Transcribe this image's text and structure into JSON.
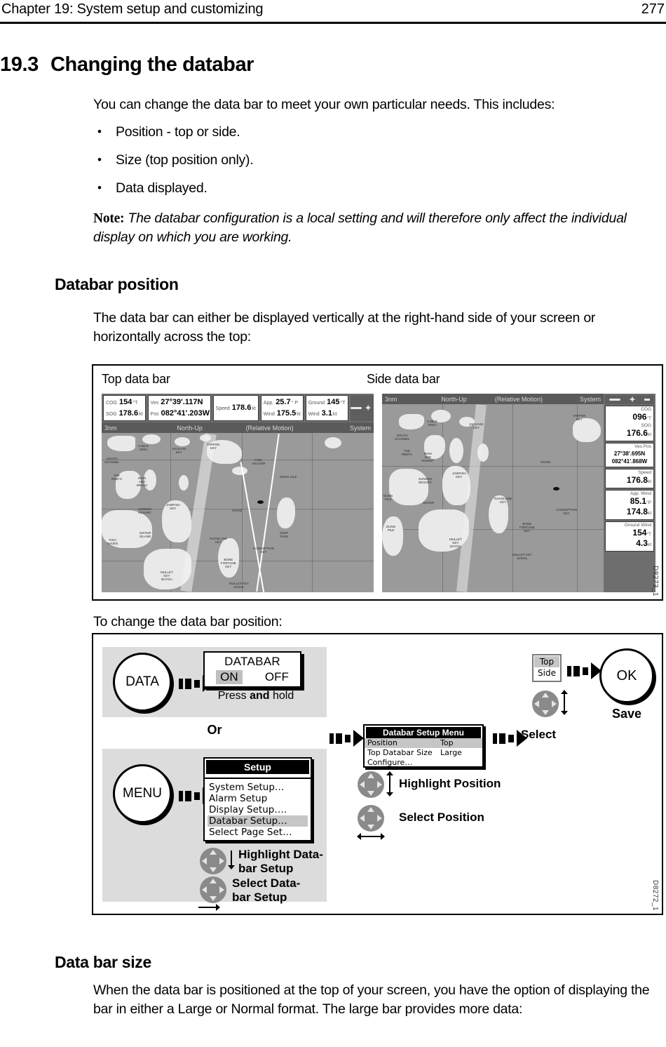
{
  "header": {
    "chapter": "Chapter 19: System setup and customizing",
    "page_number": "277"
  },
  "section": {
    "number": "19.3",
    "title": "Changing the databar"
  },
  "intro_paragraph": "You can change the data bar to meet your own particular needs. This includes:",
  "bullets": [
    "Position - top or side.",
    "Size (top position only).",
    "Data displayed."
  ],
  "note": {
    "label": "Note:",
    "text": "The databar configuration is a local setting and will therefore only affect the individual display on which you are working."
  },
  "databar_position": {
    "heading": "Databar position",
    "description": "The data bar can either be displayed vertically at the right-hand side of your screen or horizontally across the top:",
    "to_change": "To change the data bar position:"
  },
  "figure_screens": {
    "id": "D8273_1",
    "caption_top": "Top data bar",
    "caption_side": "Side data bar",
    "top_databar": {
      "cells": [
        {
          "rows": [
            {
              "label": "COG",
              "value": "154",
              "unit": "°T"
            },
            {
              "label": "SOG",
              "value": "178.6",
              "unit": "kt"
            }
          ]
        },
        {
          "rows": [
            {
              "label": "Ves",
              "value": "27°39'.117N",
              "unit": ""
            },
            {
              "label": "Pos",
              "value": "082°41'.203W",
              "unit": ""
            }
          ]
        },
        {
          "rows": [
            {
              "label": "Speed",
              "value": "178.6",
              "unit": "kt"
            }
          ]
        },
        {
          "rows": [
            {
              "label": "App.",
              "value": "25.7",
              "unit": "°  P"
            },
            {
              "label": "Wind",
              "value": "175.5",
              "unit": "kt"
            }
          ]
        },
        {
          "rows": [
            {
              "label": "Ground",
              "value": "145",
              "unit": "°T"
            },
            {
              "label": "Wind",
              "value": "3.1",
              "unit": "kt"
            }
          ]
        }
      ]
    },
    "status_strip": {
      "range": "3nm",
      "orientation": "North-Up",
      "motion": "(Relative Motion)",
      "system": "System"
    },
    "side_databar": {
      "groups": [
        {
          "items": [
            {
              "label": "COG",
              "value": "096",
              "unit": "°T"
            },
            {
              "label": "SOG",
              "value": "176.6",
              "unit": "kt"
            }
          ]
        },
        {
          "label": "Ves Pos",
          "positions": [
            "27°38'.695N",
            "082°41'.868W"
          ]
        },
        {
          "items": [
            {
              "label": "Speed",
              "value": "176.8",
              "unit": "kt"
            }
          ]
        },
        {
          "items": [
            {
              "label": "App. Wind",
              "value": "85.1",
              "unit": "°P"
            },
            {
              "label": "",
              "value": "174.8",
              "unit": "kt"
            }
          ]
        },
        {
          "items": [
            {
              "label": "Ground Wind",
              "value": "154",
              "unit": "°T"
            },
            {
              "label": "",
              "value": "4.3",
              "unit": "kt"
            }
          ]
        }
      ]
    },
    "chart_labels": [
      "SOUTH CHANNEL",
      "CABLE AREA",
      "JACKASS KEY",
      "TARPON KEY",
      "THE REEFS",
      "IRON AND BRASS",
      "SUNKEN RESORT",
      "JAWFISH KEY",
      "SISTER ISLAND",
      "FUEL",
      "SWAN ISLE",
      "RAGGLAND KEY",
      "SURF PASS",
      "CONCEPTION KEY",
      "BONE FORTUNE KEY",
      "MULLET KEY BAYOU",
      "DUNN PILE",
      "MULLET KEY SHOAL",
      "STAKE"
    ]
  },
  "figure_flow": {
    "id": "D8272_1",
    "keys": {
      "data": "DATA",
      "menu": "MENU",
      "ok": "OK"
    },
    "databar_popup": {
      "title": "DATABAR",
      "option_on": "ON",
      "option_off": "OFF",
      "hint_prefix": "Press ",
      "hint_bold": "and",
      "hint_suffix": " hold"
    },
    "or_label": "Or",
    "setup_menu": {
      "title": "Setup",
      "items": [
        {
          "label": "System Setup…",
          "selected": false
        },
        {
          "label": "Alarm Setup",
          "selected": false
        },
        {
          "label": "Display Setup….",
          "selected": false
        },
        {
          "label": "Databar Setup…",
          "selected": true
        },
        {
          "label": "Select Page Set…",
          "selected": false
        }
      ]
    },
    "databar_setup_menu": {
      "title": "Databar Setup Menu",
      "rows": [
        {
          "label": "Position",
          "value": "Top",
          "selected": true
        },
        {
          "label": "Top Databar Size",
          "value": "Large",
          "selected": false
        },
        {
          "label": "Configure…",
          "value": "",
          "selected": false
        }
      ]
    },
    "position_selector": {
      "option_top": "Top",
      "option_side": "Side"
    },
    "step_labels": {
      "highlight_databar_setup": "Highlight Data-\nbar Setup",
      "highlight_databar_setup_l1": "Highlight Data-",
      "highlight_databar_setup_l2": "bar Setup",
      "select_databar_setup_l1": "Select Data-",
      "select_databar_setup_l2": "bar Setup",
      "highlight_position": "Highlight Position",
      "select_position": "Select Position",
      "select": "Select",
      "save": "Save"
    }
  },
  "data_bar_size": {
    "heading": "Data bar size",
    "description": "When the data bar is positioned at the top of your screen, you have the option of displaying the bar in either a Large or Normal format. The large bar provides more data:"
  },
  "colors": {
    "selection_gray": "#c6c6c6",
    "panel_gray": "#dcdcdc",
    "chart_water": "#9a9a9a",
    "chart_land": "#e9e9e9",
    "bar_gray": "#6e6e6e"
  }
}
